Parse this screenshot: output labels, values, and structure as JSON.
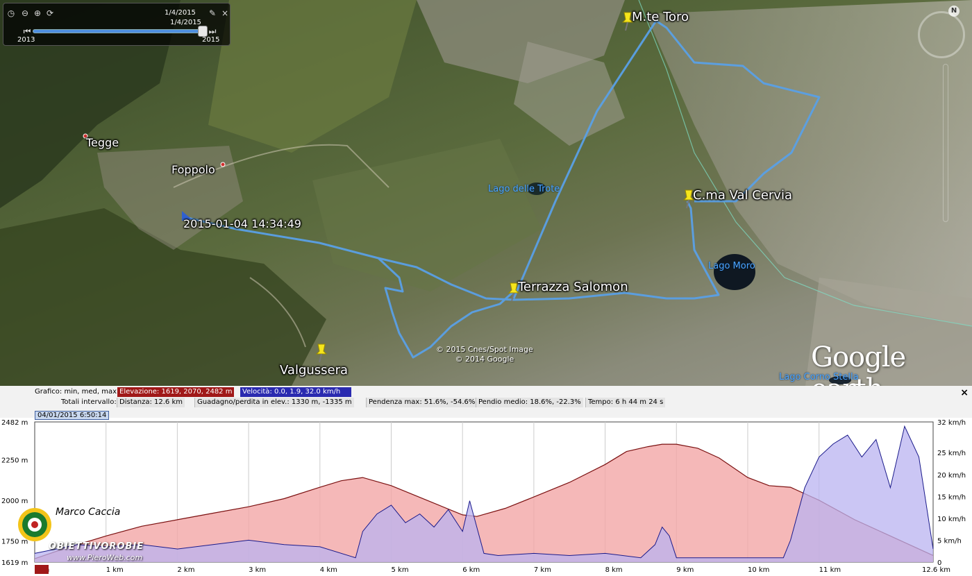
{
  "time_slider": {
    "current_date": "1/4/2015",
    "thumb_date": "1/4/2015",
    "start_year": "2013",
    "end_year": "2015",
    "position_fraction": 0.96
  },
  "map": {
    "places": [
      {
        "name": "Tegge",
        "icon": "red-dot"
      },
      {
        "name": "Foppolo",
        "icon": "red-dot"
      }
    ],
    "placemarks": [
      {
        "label": "M.te Toro"
      },
      {
        "label": "C.ma Val Cervia"
      },
      {
        "label": "Terrazza Salomon"
      },
      {
        "label": "Valgussera"
      }
    ],
    "start_label": "2015-01-04 14:34:49",
    "lakes": [
      "Lago delle Trote",
      "Lago Moro",
      "Lago Corno Stella"
    ],
    "copyright_lines": [
      "© 2015 Cnes/Spot Image",
      "© 2014 Google"
    ],
    "brand": "Google earth",
    "track_color": "#5aa0e6"
  },
  "profile": {
    "stats": {
      "grafico": "Grafico: min, med, max:",
      "elevazione": "Elevazione: 1619, 2070, 2482 m",
      "velocita": "Velocità: 0.0, 1.9, 32.0 km/h",
      "totali": "Totali intervallo:",
      "distanza": "Distanza: 12.6 km",
      "guadagno": "Guadagno/perdita in elev.: 1330 m, -1335 m",
      "pendenza": "Pendenza max: 51.6%, -54.6%",
      "pendio": "Pendio medio: 18.6%, -22.3%",
      "tempo": "Tempo: 6 h 44 m 24 s"
    },
    "cursor_date": "04/01/2015 6:50:14",
    "close_symbol": "×"
  },
  "chart_data": {
    "type": "area",
    "x_unit": "km",
    "x_ticks": [
      "0 m",
      "1 km",
      "2 km",
      "3 km",
      "4 km",
      "5 km",
      "6 km",
      "7 km",
      "8 km",
      "9 km",
      "10 km",
      "11 km",
      "12.6 km"
    ],
    "xlim": [
      0,
      12.6
    ],
    "left_axis": {
      "label_ticks": [
        "2482 m",
        "2250 m",
        "2000 m",
        "1750 m",
        "1619 m"
      ],
      "ylim": [
        1619,
        2482
      ],
      "clipped_ticks": [
        "162"
      ]
    },
    "right_axis": {
      "label_ticks": [
        "32 km/h",
        "25 km/h",
        "20 km/h",
        "15 km/h",
        "10 km/h",
        "5 km/h",
        "0"
      ],
      "ylim": [
        0,
        32
      ]
    },
    "series": [
      {
        "name": "Elevazione",
        "color": "#f2a6a6",
        "x": [
          0,
          0.4,
          1,
          1.5,
          2,
          2.5,
          3,
          3.5,
          4,
          4.3,
          4.6,
          5,
          5.5,
          6,
          6.2,
          6.6,
          7,
          7.5,
          8,
          8.3,
          8.6,
          8.8,
          9,
          9.3,
          9.6,
          10,
          10.3,
          10.6,
          11,
          11.5,
          12,
          12.6
        ],
        "y": [
          1640,
          1700,
          1780,
          1840,
          1880,
          1920,
          1960,
          2010,
          2080,
          2120,
          2140,
          2090,
          2000,
          1910,
          1900,
          1950,
          2020,
          2110,
          2220,
          2300,
          2330,
          2345,
          2345,
          2320,
          2260,
          2140,
          2090,
          2080,
          2000,
          1880,
          1780,
          1660
        ]
      },
      {
        "name": "Velocità",
        "color": "#b9b3f0",
        "x": [
          0,
          0.3,
          0.6,
          1,
          1.5,
          2,
          2.5,
          3,
          3.5,
          4,
          4.5,
          4.6,
          4.8,
          5,
          5.2,
          5.4,
          5.6,
          5.8,
          6,
          6.1,
          6.3,
          6.5,
          7,
          7.5,
          8,
          8.5,
          8.7,
          8.8,
          8.9,
          9,
          9.5,
          10,
          10.5,
          10.6,
          10.8,
          11,
          11.2,
          11.4,
          11.6,
          11.8,
          12,
          12.2,
          12.4,
          12.6
        ],
        "y": [
          2,
          3,
          4,
          3.5,
          4,
          3,
          4,
          5,
          4,
          3.5,
          1,
          7,
          11,
          13,
          9,
          11,
          8,
          12,
          7,
          14,
          2,
          1.5,
          2,
          1.5,
          2,
          1,
          4,
          8,
          6,
          1,
          1,
          1,
          1,
          5,
          17,
          24,
          27,
          29,
          24,
          28,
          17,
          31,
          24,
          3
        ]
      }
    ]
  }
}
